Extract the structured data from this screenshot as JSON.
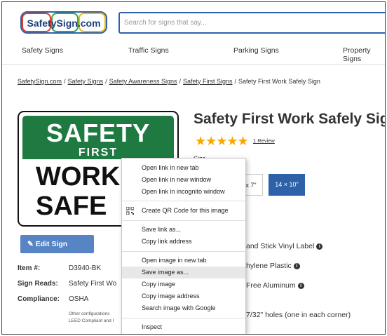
{
  "header": {
    "logo_text": "SafetySign.com",
    "search_placeholder": "Search for signs that say..."
  },
  "nav": [
    "Safety Signs",
    "Traffic Signs",
    "Parking Signs",
    "Property Signs"
  ],
  "breadcrumb": [
    "SafetySign.com",
    "Safety Signs",
    "Safety Awareness Signs",
    "Safety First Signs",
    "Safety First Work Safely Sign"
  ],
  "product": {
    "title": "Safety First Work Safely Sign",
    "stars": "★★★★★",
    "review_link": "1 Review",
    "size_label": "Size",
    "sizes": [
      "x 7\"",
      "14 × 10\""
    ],
    "edit_button": "Edit Sign",
    "sign_image_text": {
      "line1": "SAFETY",
      "line2": "FIRST",
      "line3": "WORK",
      "line4": "SAFE"
    },
    "specs": [
      {
        "label": "Item #:",
        "value": "D3940-BK"
      },
      {
        "label": "Sign Reads:",
        "value": "Safety First Wo"
      },
      {
        "label": "Compliance:",
        "value": "OSHA"
      }
    ],
    "note_line1": "Other configurations",
    "note_line2": "LEED Compliant and I",
    "materials": [
      "and Stick Vinyl Label",
      "hylene Plastic",
      "Free Aluminum",
      "7/32\" holes (one in each corner)"
    ]
  },
  "context_menu": {
    "items": [
      "Open link in new tab",
      "Open link in new window",
      "Open link in incognito window",
      "Create QR Code for this image",
      "Save link as...",
      "Copy link address",
      "Open image in new tab",
      "Save image as...",
      "Copy image",
      "Copy image address",
      "Search image with Google",
      "Inspect"
    ],
    "highlighted": "Save image as..."
  }
}
